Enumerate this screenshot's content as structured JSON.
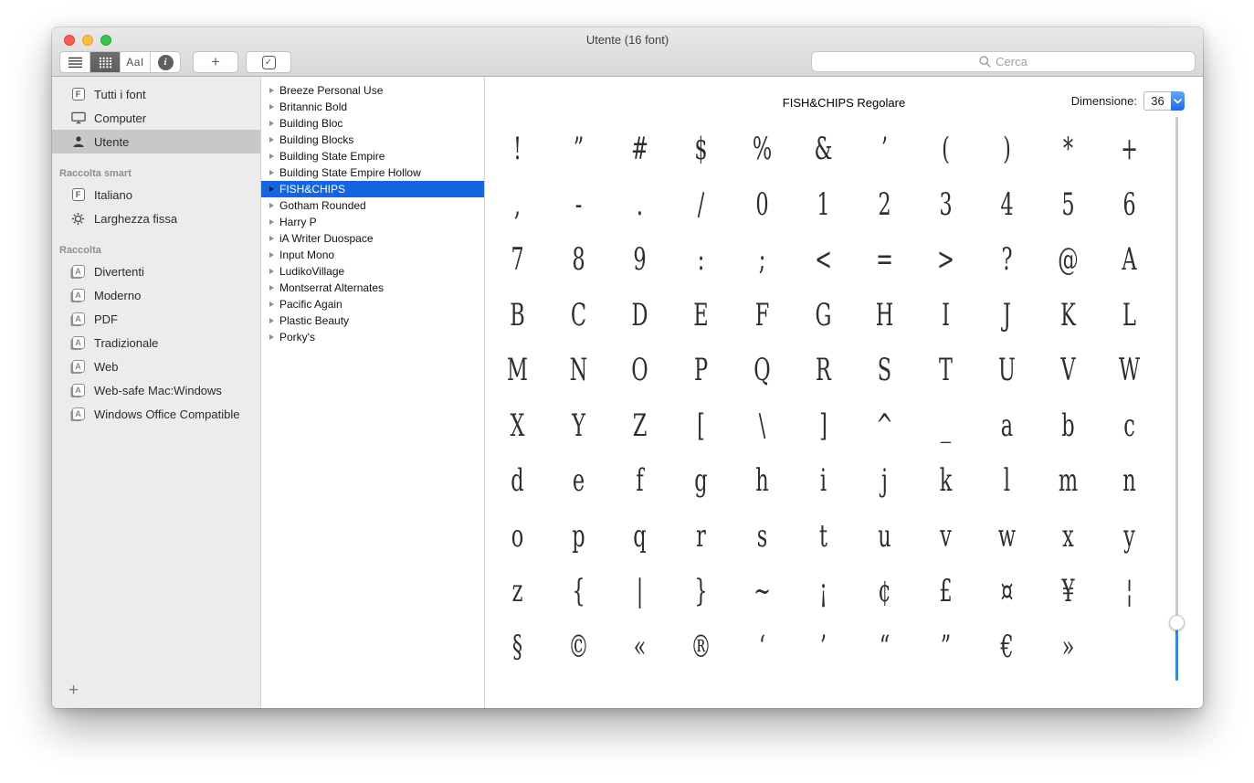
{
  "window": {
    "title": "Utente (16 font)"
  },
  "toolbar": {
    "sample_label": "AaI",
    "info_label": "i",
    "add_label": "+",
    "search": {
      "placeholder": "Cerca"
    }
  },
  "icons": {
    "font_box_letter": "F",
    "collection_letter": "A",
    "checkbox": "✓"
  },
  "sidebar": {
    "groups": [
      {
        "header": "",
        "items": [
          {
            "label": "Tutti i font",
            "icon": "font-box-icon",
            "selected": false
          },
          {
            "label": "Computer",
            "icon": "computer-icon",
            "selected": false
          },
          {
            "label": "Utente",
            "icon": "user-icon",
            "selected": true
          }
        ]
      },
      {
        "header": "Raccolta smart",
        "items": [
          {
            "label": "Italiano",
            "icon": "font-box-icon",
            "selected": false
          },
          {
            "label": "Larghezza fissa",
            "icon": "gear-icon",
            "selected": false
          }
        ]
      },
      {
        "header": "Raccolta",
        "items": [
          {
            "label": "Divertenti",
            "icon": "collection-icon",
            "selected": false
          },
          {
            "label": "Moderno",
            "icon": "collection-icon",
            "selected": false
          },
          {
            "label": "PDF",
            "icon": "collection-icon",
            "selected": false
          },
          {
            "label": "Tradizionale",
            "icon": "collection-icon",
            "selected": false
          },
          {
            "label": "Web",
            "icon": "collection-icon",
            "selected": false
          },
          {
            "label": "Web-safe Mac:Windows",
            "icon": "collection-icon",
            "selected": false
          },
          {
            "label": "Windows Office Compatible",
            "icon": "collection-icon",
            "selected": false
          }
        ]
      }
    ],
    "add_label": "+"
  },
  "font_list": {
    "selected": "FISH&CHIPS",
    "items": [
      "Breeze Personal Use",
      "Britannic Bold",
      "Building Bloc",
      "Building Blocks",
      "Building State Empire",
      "Building State Empire Hollow",
      "FISH&CHIPS",
      "Gotham Rounded",
      "Harry P",
      "iA Writer Duospace",
      "Input Mono",
      "LudikoVillage",
      "Montserrat Alternates",
      "Pacific Again",
      "Plastic Beauty",
      "Porky's"
    ]
  },
  "preview": {
    "title": "FISH&CHIPS Regolare",
    "size_label": "Dimensione:",
    "size_value": "36",
    "glyph_rows": [
      [
        "!",
        "”",
        "#",
        "$",
        "%",
        "&",
        "’",
        "(",
        ")",
        "*",
        "+"
      ],
      [
        ",",
        "-",
        ".",
        "/",
        "0",
        "1",
        "2",
        "3",
        "4",
        "5",
        "6"
      ],
      [
        "7",
        "8",
        "9",
        ":",
        ";",
        "<",
        "=",
        ">",
        "?",
        "@",
        "A"
      ],
      [
        "B",
        "C",
        "D",
        "E",
        "F",
        "G",
        "H",
        "I",
        "J",
        "K",
        "L"
      ],
      [
        "M",
        "N",
        "O",
        "P",
        "Q",
        "R",
        "S",
        "T",
        "U",
        "V",
        "W"
      ],
      [
        "X",
        "Y",
        "Z",
        "[",
        "\\",
        "]",
        "^",
        "_",
        "a",
        "b",
        "c"
      ],
      [
        "d",
        "e",
        "f",
        "g",
        "h",
        "i",
        "j",
        "k",
        "l",
        "m",
        "n"
      ],
      [
        "o",
        "p",
        "q",
        "r",
        "s",
        "t",
        "u",
        "v",
        "w",
        "x",
        "y"
      ],
      [
        "z",
        "{",
        "|",
        "}",
        "~",
        "¡",
        "¢",
        "£",
        "¤",
        "¥",
        "¦"
      ],
      [
        "§",
        "©",
        "«",
        "®",
        "‘",
        "’",
        "“",
        "”",
        "€",
        "»"
      ]
    ]
  },
  "colors": {
    "selection_blue": "#1265e3",
    "slider_blue": "#1e8eff",
    "sidebar_selected": "#c8c8c8",
    "header_gradient_top": "#e9e9e9",
    "header_gradient_bottom": "#d8d8d8"
  }
}
